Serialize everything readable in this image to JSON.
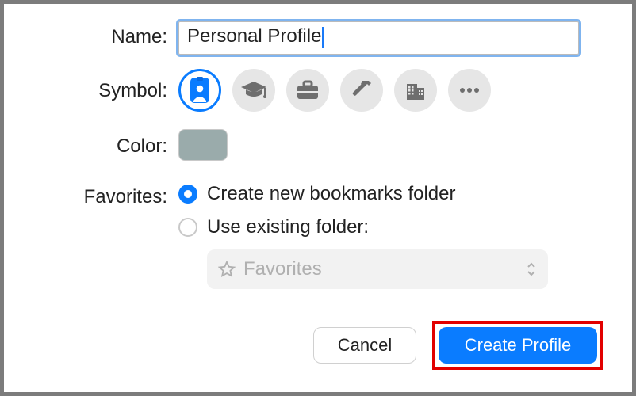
{
  "labels": {
    "name": "Name:",
    "symbol": "Symbol:",
    "color": "Color:",
    "favorites": "Favorites:"
  },
  "name_field": {
    "value": "Personal Profile"
  },
  "symbols": [
    {
      "id": "badge",
      "selected": true
    },
    {
      "id": "graduation",
      "selected": false
    },
    {
      "id": "briefcase",
      "selected": false
    },
    {
      "id": "hammer",
      "selected": false
    },
    {
      "id": "building",
      "selected": false
    },
    {
      "id": "more",
      "selected": false
    }
  ],
  "color": {
    "value": "#9aabab"
  },
  "favorites": {
    "options": [
      {
        "id": "create-new",
        "label": "Create new bookmarks folder",
        "checked": true
      },
      {
        "id": "use-existing",
        "label": "Use existing folder:",
        "checked": false
      }
    ],
    "popup": {
      "value": "Favorites",
      "enabled": false
    }
  },
  "buttons": {
    "cancel": "Cancel",
    "create": "Create Profile"
  }
}
